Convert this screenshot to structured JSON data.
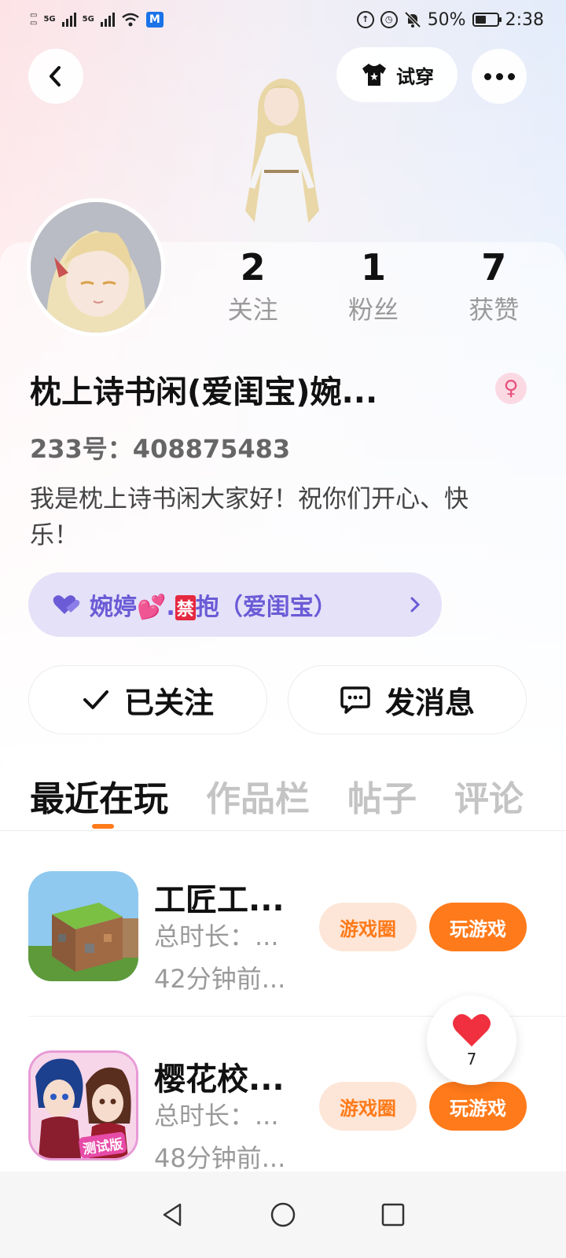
{
  "status_bar": {
    "network_1": "5G",
    "network_2": "5G",
    "battery": "50%",
    "time": "2:38"
  },
  "header": {
    "back_icon": "chevron-left-icon",
    "try_on_label": "试穿",
    "more_icon": "more-dots-icon"
  },
  "profile": {
    "stats": [
      {
        "value": "2",
        "label": "关注"
      },
      {
        "value": "1",
        "label": "粉丝"
      },
      {
        "value": "7",
        "label": "获赞"
      }
    ],
    "nickname": "枕上诗书闲(爱闺宝)婉...",
    "gender_symbol": "♀",
    "user_id": "233号：408875483",
    "bio": "我是枕上诗书闲大家好！祝你们开心、快乐！",
    "relation_prefix": "婉婷💕.",
    "relation_badge": "禁",
    "relation_suffix": "抱（爱闺宝）",
    "follow_label": "已关注",
    "message_label": "发消息"
  },
  "tabs": [
    {
      "label": "最近在玩",
      "active": true
    },
    {
      "label": "作品栏",
      "active": false
    },
    {
      "label": "帖子",
      "active": false
    },
    {
      "label": "评论",
      "active": false
    }
  ],
  "games": [
    {
      "name": "工匠工...",
      "duration": "总时长：...",
      "last_played": "42分钟前...",
      "circle_label": "游戏圈",
      "play_label": "玩游戏"
    },
    {
      "name": "樱花校...",
      "duration": "总时长：...",
      "last_played": "48分钟前...",
      "circle_label": "游戏圈",
      "play_label": "玩游戏",
      "icon_badge": "测试版"
    }
  ],
  "like_button": {
    "count": "7"
  },
  "colors": {
    "accent_orange": "#ff7a1a",
    "relation_purple": "#6b5bd6",
    "heart_red": "#f0303f"
  }
}
